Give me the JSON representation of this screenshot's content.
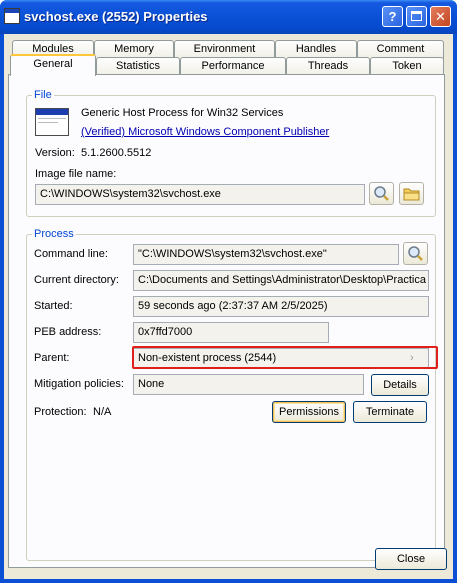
{
  "window": {
    "title": "svchost.exe (2552) Properties",
    "help_glyph": "?",
    "close_glyph": "✕"
  },
  "tabs_row1": [
    "Modules",
    "Memory",
    "Environment",
    "Handles",
    "Comment"
  ],
  "tabs_row2": [
    "General",
    "Statistics",
    "Performance",
    "Threads",
    "Token"
  ],
  "active_tab": "General",
  "file": {
    "legend": "File",
    "description": "Generic Host Process for Win32 Services",
    "publisher_link": "(Verified) Microsoft Windows Component Publisher",
    "version_label": "Version:",
    "version_value": "5.1.2600.5512",
    "image_label": "Image file name:",
    "image_path": "C:\\WINDOWS\\system32\\svchost.exe"
  },
  "process": {
    "legend": "Process",
    "command_line_label": "Command line:",
    "command_line": "\"C:\\WINDOWS\\system32\\svchost.exe\"",
    "current_dir_label": "Current directory:",
    "current_dir": "C:\\Documents and Settings\\Administrator\\Desktop\\Practica",
    "started_label": "Started:",
    "started": "59 seconds ago (2:37:37 AM 2/5/2025)",
    "peb_label": "PEB address:",
    "peb": "0x7ffd7000",
    "parent_label": "Parent:",
    "parent": "Non-existent process (2544)",
    "parent_arrow": "›",
    "mitigation_label": "Mitigation policies:",
    "mitigation": "None",
    "details_button": "Details",
    "protection_label": "Protection:",
    "protection": "N/A",
    "permissions_button": "Permissions",
    "terminate_button": "Terminate"
  },
  "footer": {
    "close_button": "Close"
  },
  "colors": {
    "titlebar": "#0a52d8",
    "dialog_bg": "#ece9d8",
    "group_title": "#0046d5",
    "link": "#0000b0",
    "highlight": "#e0201a"
  },
  "icons": [
    "app-window-icon",
    "search-icon",
    "folder-icon",
    "help-icon",
    "maximize-icon",
    "close-icon"
  ]
}
